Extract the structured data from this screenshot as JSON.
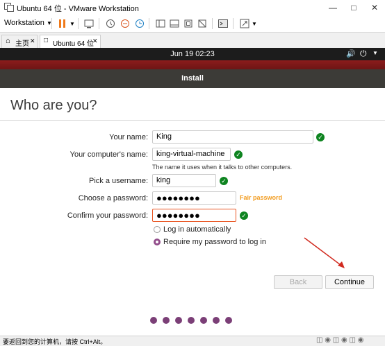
{
  "window": {
    "title": "Ubuntu 64 位 - VMware Workstation"
  },
  "toolbar": {
    "menu_label": "Workstation"
  },
  "tabs": [
    {
      "label": "主页",
      "icon": "home-icon"
    },
    {
      "label": "Ubuntu 64 位",
      "icon": "vm-icon"
    }
  ],
  "topbar": {
    "datetime": "Jun 19  02:23"
  },
  "installer": {
    "header": "Install",
    "heading": "Who are you?",
    "fields": {
      "your_name": {
        "label": "Your name:",
        "value": "King"
      },
      "computer_name": {
        "label": "Your computer's name:",
        "value": "king-virtual-machine",
        "hint": "The name it uses when it talks to other computers."
      },
      "username": {
        "label": "Pick a username:",
        "value": "king"
      },
      "password": {
        "label": "Choose a password:",
        "value": "●●●●●●●●",
        "strength": "Fair password"
      },
      "confirm": {
        "label": "Confirm your password:",
        "value": "●●●●●●●●"
      }
    },
    "login_options": {
      "auto": "Log in automatically",
      "require": "Require my password to log in",
      "selected": "require"
    },
    "back_label": "Back",
    "continue_label": "Continue",
    "progress_dots": 7
  },
  "statusbar": {
    "text": "要返回到您的计算机，请按 Ctrl+Alt。"
  },
  "colors": {
    "accent": "#e95420",
    "ok": "#0e8420",
    "aubergine": "#7b3f77"
  }
}
